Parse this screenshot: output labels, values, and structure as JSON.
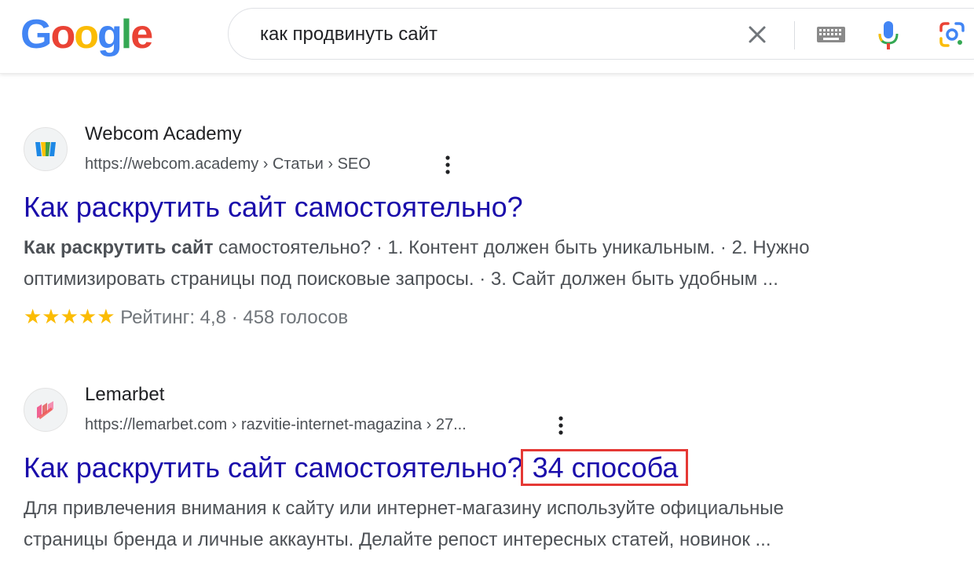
{
  "search": {
    "query": "как продвинуть сайт"
  },
  "logo": {
    "letters": [
      "G",
      "o",
      "o",
      "g",
      "l",
      "e"
    ]
  },
  "icons": {
    "clear": "close-icon",
    "keyboard": "keyboard-icon",
    "voice": "microphone-icon",
    "lens": "camera-lens-icon"
  },
  "results": [
    {
      "site_name": "Webcom Academy",
      "url": "https://webcom.academy › Статьи › SEO",
      "title": "Как раскрутить сайт самостоятельно?",
      "snippet_bold": "Как раскрутить сайт",
      "snippet_line1_rest": " самостоятельно? · 1. Контент должен быть уникальным. · 2. Нужно",
      "snippet_line2": "оптимизировать страницы под поисковые запросы. · 3. Сайт должен быть удобным ...",
      "stars": "★★★★★",
      "rating_text": "Рейтинг: 4,8 · 458 голосов"
    },
    {
      "site_name": "Lemarbet",
      "url": "https://lemarbet.com › razvitie-internet-magazina › 27...",
      "title_main": "Как раскрутить сайт самостоятельно?",
      "title_highlight": "34 способа",
      "snippet_line1": "Для привлечения внимания к сайту или интернет-магазину используйте официальные",
      "snippet_line2": "страницы бренда и личные аккаунты. Делайте репост интересных статей, новинок ..."
    }
  ],
  "colors": {
    "link": "#1a0dab",
    "highlight_border": "#e53935",
    "stars": "#fbbc04"
  }
}
